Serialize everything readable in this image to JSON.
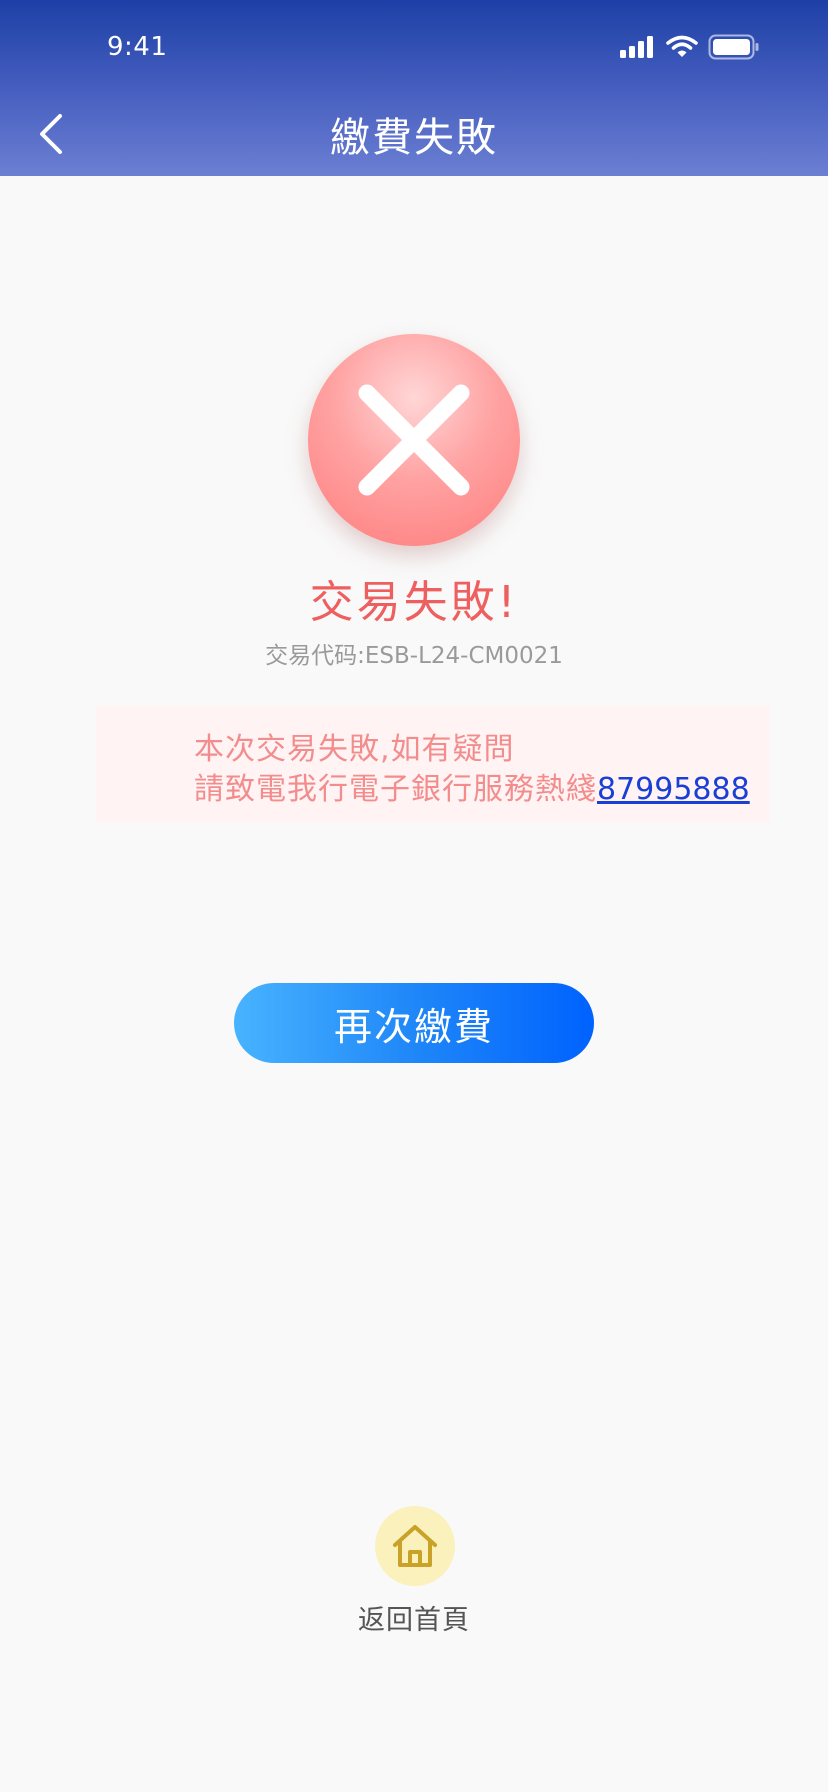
{
  "status_bar": {
    "time": "9:41"
  },
  "header": {
    "title": "繳費失敗",
    "back_icon": "chevron-left-icon"
  },
  "result": {
    "icon": "close-icon",
    "title": "交易失敗!",
    "code_label": "交易代码:",
    "code_value": "ESB-L24-CM0021"
  },
  "notice": {
    "line1": "本次交易失敗,如有疑問",
    "line2_prefix": "請致電我行電子銀行服務熱綫",
    "hotline": "87995888"
  },
  "actions": {
    "retry_label": "再次繳費"
  },
  "footer": {
    "home_icon": "home-icon",
    "home_label": "返回首頁"
  },
  "colors": {
    "header_gradient_top": "#1d40a6",
    "header_gradient_bottom": "#6b7fd2",
    "error_red": "#ee5f5f",
    "notice_text": "#f38d8d",
    "notice_bg": "#fff3f3",
    "link_blue": "#1a3fd6",
    "button_gradient_start": "#48b3ff",
    "button_gradient_end": "#0062ff",
    "home_icon_bg": "#fbf1bd",
    "home_icon_stroke": "#c9a227"
  }
}
